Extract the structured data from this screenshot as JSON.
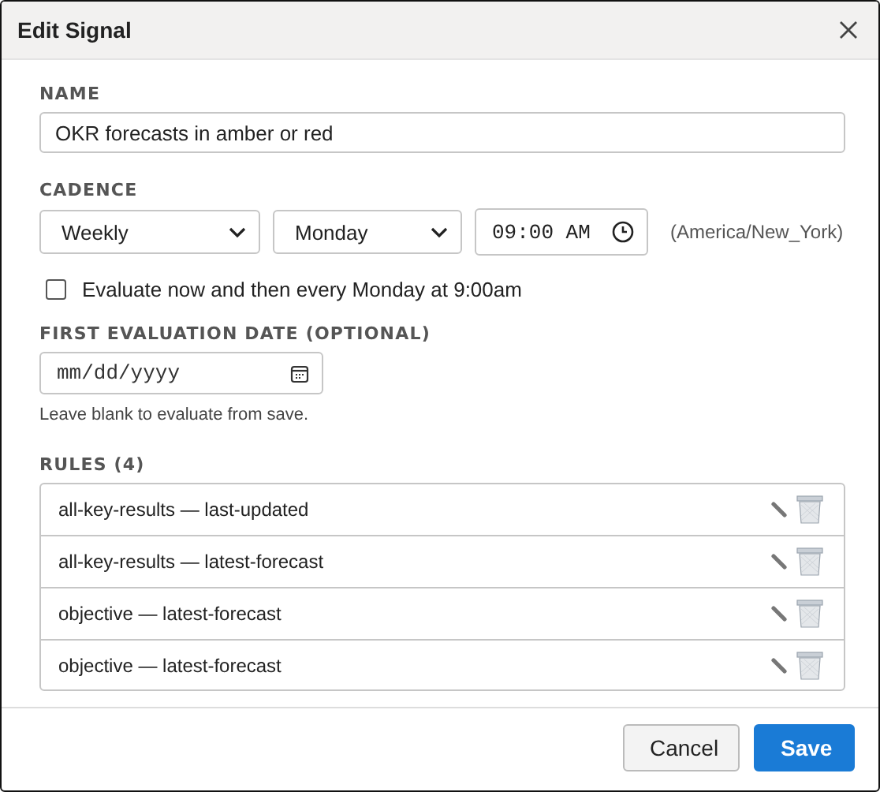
{
  "window": {
    "title": "Edit Signal"
  },
  "name": {
    "label": "NAME",
    "value": "OKR forecasts in amber or red"
  },
  "cadence": {
    "label": "CADENCE",
    "frequency": "Weekly",
    "day": "Monday",
    "time": "09:00 AM",
    "timezone": "(America/New_York)"
  },
  "evaluate_now": {
    "label": "Evaluate now and then every Monday at 9:00am",
    "checked": false
  },
  "first_evaluation": {
    "label": "FIRST EVALUATION DATE (OPTIONAL)",
    "placeholder": "mm/dd/yyyy",
    "help": "Leave blank to evaluate from save."
  },
  "rules": {
    "label": "RULES (4)",
    "items": [
      {
        "text": "all-key-results — last-updated"
      },
      {
        "text": "all-key-results — latest-forecast"
      },
      {
        "text": "objective — latest-forecast"
      },
      {
        "text": "objective — latest-forecast"
      }
    ]
  },
  "buttons": [
    {
      "label": "Cancel",
      "kind": "secondary"
    },
    {
      "label": "Save",
      "kind": "primary"
    }
  ]
}
